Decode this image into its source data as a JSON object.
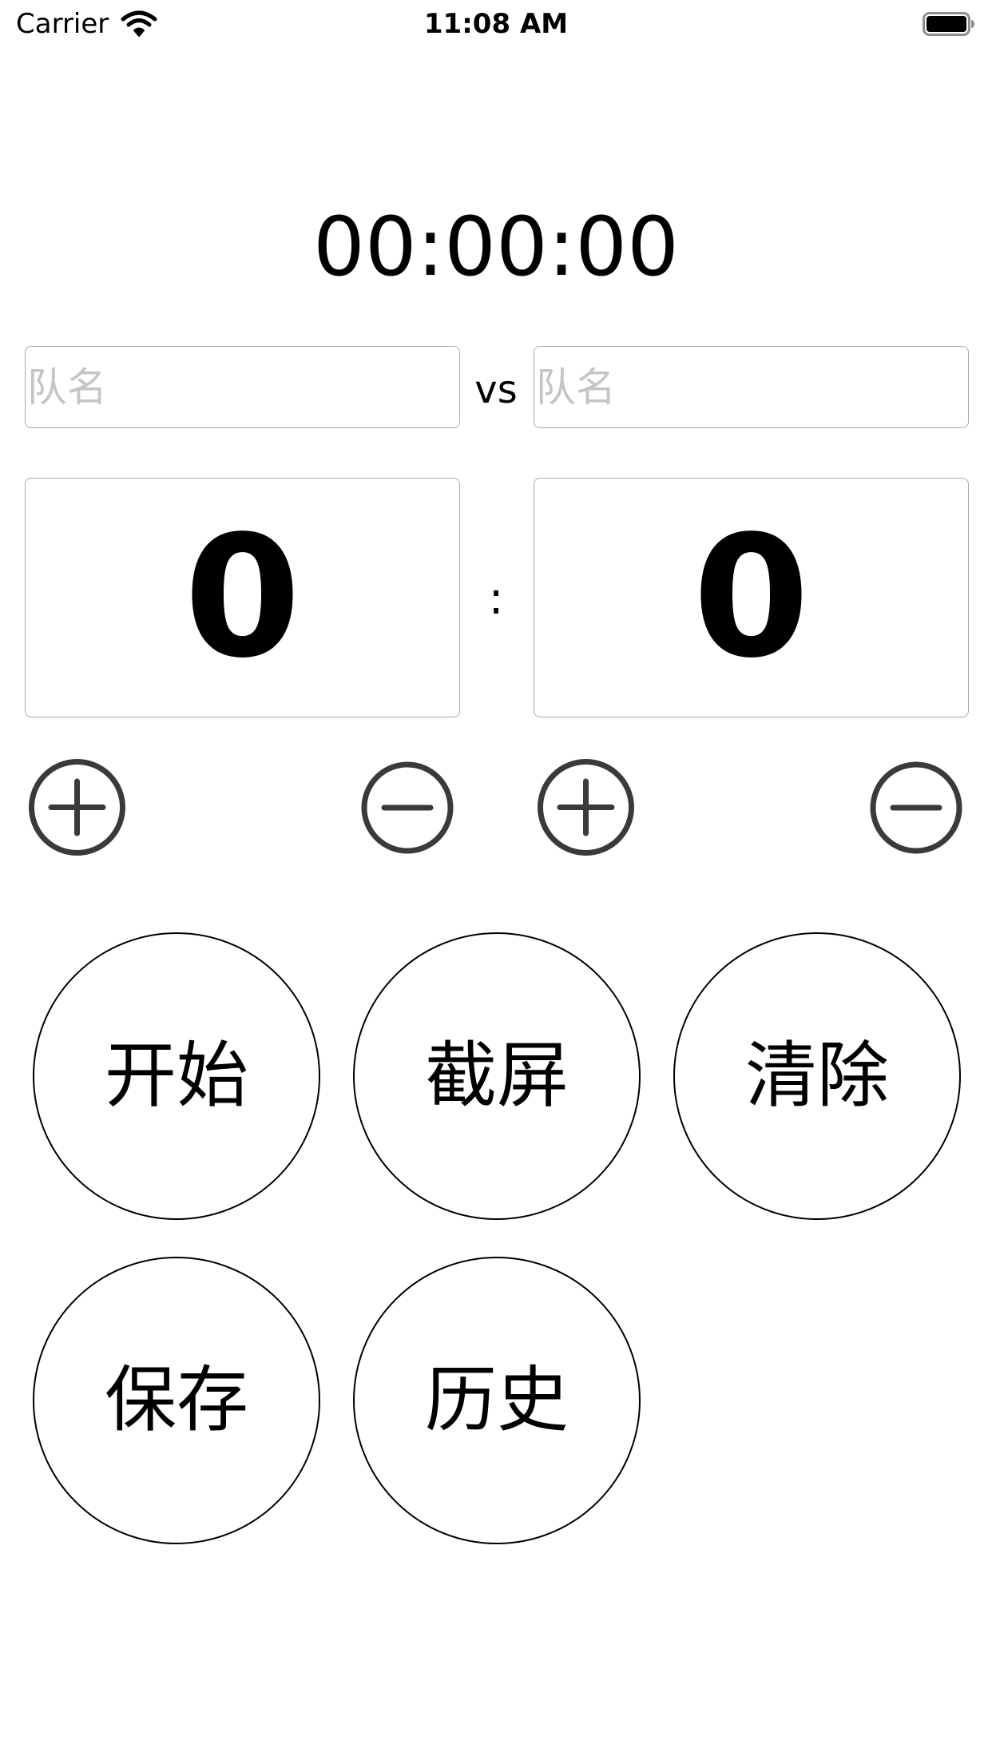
{
  "status_bar": {
    "carrier": "Carrier",
    "time": "11:08 AM",
    "wifi_icon": "wifi-icon",
    "battery_icon": "battery-icon",
    "battery_level": 1.0
  },
  "timer": {
    "display": "00:00:00"
  },
  "teams": {
    "left_placeholder": "队名",
    "right_placeholder": "队名",
    "left_value": "",
    "right_value": "",
    "vs_label": "vs"
  },
  "scores": {
    "left": "0",
    "right": "0",
    "separator": ":"
  },
  "controls": {
    "left_plus_icon": "plus-circle-icon",
    "left_minus_icon": "minus-circle-icon",
    "right_plus_icon": "plus-circle-icon",
    "right_minus_icon": "minus-circle-icon"
  },
  "actions": {
    "start": "开始",
    "screenshot": "截屏",
    "clear": "清除",
    "save": "保存",
    "history": "历史"
  },
  "colors": {
    "background": "#ffffff",
    "text": "#000000",
    "placeholder": "#c4c4c9",
    "field_border": "#a9a9a9",
    "icon_stroke": "#3a3a3a"
  }
}
